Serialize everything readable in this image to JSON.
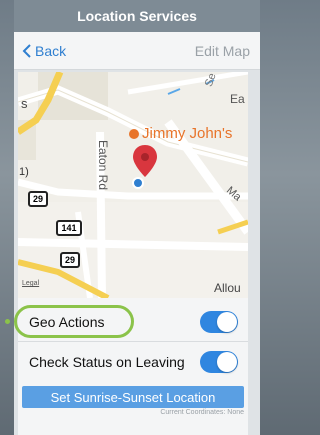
{
  "title": "Location Services",
  "nav": {
    "back_label": "Back",
    "edit_map_label": "Edit Map"
  },
  "map": {
    "poi_label": "Jimmy John's",
    "street_eaton": "Eaton Rd",
    "street_se": "Se",
    "street_ea": "Ea",
    "street_ma": "Ma",
    "street_allou": "Allou",
    "route_29_a": "29",
    "route_141": "141",
    "route_29_b": "29",
    "legal": "Legal",
    "left_marker": "1)",
    "s_marker": "s"
  },
  "settings": {
    "geo_actions_label": "Geo Actions",
    "geo_actions_on": true,
    "check_status_label": "Check Status on Leaving",
    "check_status_on": true,
    "sunrise_button_label": "Set Sunrise-Sunset Location",
    "current_coordinates": "Current Coordinates: None"
  },
  "colors": {
    "accent": "#2f86e0",
    "highlight": "#8bc34a",
    "poi": "#e8742a",
    "pin": "#d9363e"
  }
}
